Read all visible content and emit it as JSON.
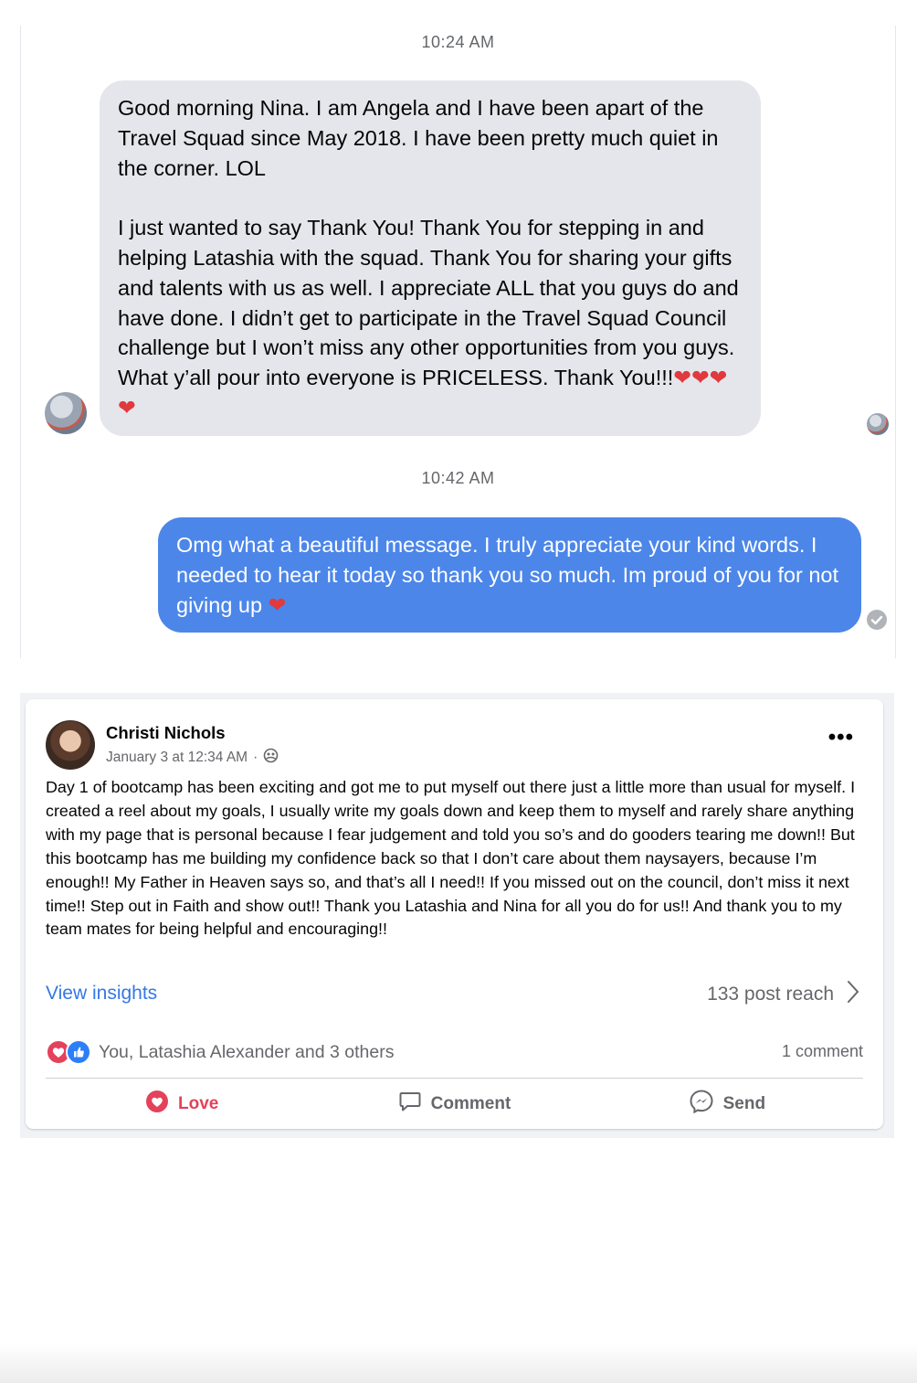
{
  "chat": {
    "timestamp_1": "10:24 AM",
    "incoming_message": "Good morning Nina.  I am Angela and I have been apart of the Travel Squad since May 2018.  I have been pretty much quiet in the corner. LOL\n\nI just wanted to say Thank You!  Thank You for stepping in and helping Latashia with the squad.  Thank You for sharing your gifts and talents with us as well.  I appreciate ALL that you guys do and have done.  I didn’t get to participate in the Travel Squad Council challenge but I won’t miss any other opportunities from you guys.  What y’all pour into everyone is PRICELESS. Thank You!!!",
    "incoming_emoji": "❤❤❤❤",
    "timestamp_2": "10:42 AM",
    "outgoing_message": "Omg what a beautiful message. I truly appreciate your kind words. I needed to hear it today so thank you so much. Im proud of you for not giving up",
    "outgoing_emoji": "❤"
  },
  "post": {
    "author": "Christi Nichols",
    "date": "January 3 at 12:34 AM",
    "separator": "·",
    "more_icon": "•••",
    "body": "Day 1 of bootcamp has been exciting and got me to put myself out there just a little more than usual for myself. I created a reel about my goals, I usually write my goals down and keep them to myself and rarely share anything with my page that is personal because I fear judgement and told you so’s and do gooders tearing me down!! But this bootcamp has me building my confidence back so that I don’t care about them naysayers, because I’m enough!! My Father in Heaven says so, and that’s all I need!! If you missed out on the council, don’t miss it next time!! Step out in Faith and show out!! Thank you Latashia and Nina for all you do for us!! And thank you to my team mates for being helpful and encouraging!!",
    "view_insights": "View insights",
    "post_reach": "133 post reach",
    "reactions_text": "You, Latashia Alexander and 3 others",
    "comments_count": "1 comment",
    "actions": {
      "love": "Love",
      "comment": "Comment",
      "send": "Send"
    }
  },
  "colors": {
    "outgoing_bubble": "#4c86e9",
    "incoming_bubble": "#e4e6eb",
    "link_blue": "#3578e5",
    "love_red": "#e4415a"
  }
}
